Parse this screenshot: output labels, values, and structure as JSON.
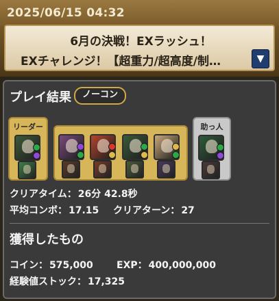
{
  "header": {
    "timestamp": "2025/06/15 04:32",
    "quest_line1": "6月の決戦！EXラッシュ！",
    "quest_line2": "EXチャレンジ！【超重力/超高度/制…",
    "expand_icon": "triangle-down-icon"
  },
  "result": {
    "title": "プレイ結果",
    "badge": "ノーコン"
  },
  "party": {
    "leader_label": "リーダー",
    "helper_label": "助っ人",
    "colors": {
      "leader_group": "#d7b659",
      "helper_group": "#c9c9c9"
    },
    "leader": {
      "name": "leader-card",
      "color": "#3d5a3a",
      "orbs": [
        "#2ba84a",
        "#8e4ad6"
      ],
      "assist_color": "#3f7f4a"
    },
    "subs": [
      {
        "name": "sub-card-1",
        "color": "#7a4a7e",
        "orbs": [
          "#8e4ad6",
          "#2ba84a"
        ],
        "assist_color": "#5b3a2a"
      },
      {
        "name": "sub-card-2",
        "color": "#b2452e",
        "orbs": [
          "#d8382c",
          "#ddb84a"
        ],
        "assist_color": "#7a3b28"
      },
      {
        "name": "sub-card-3",
        "color": "#3a5a3a",
        "orbs": [
          "#2ba84a",
          "#ddb84a"
        ],
        "assist_color": "#4a5a3a"
      },
      {
        "name": "sub-card-4",
        "color": "#c9a87a",
        "orbs": [
          "#ddb84a",
          "#2ba84a"
        ],
        "assist_color": "#4a3a5a"
      }
    ],
    "helper": {
      "name": "helper-card",
      "color": "#2e5b3a",
      "orbs": [
        "#2ba84a",
        "#8e4ad6"
      ],
      "assist_color": "#4a3a3a"
    }
  },
  "stats": {
    "clear_time_label": "クリアタイム：",
    "clear_time_value": "26分 42.8秒",
    "avg_combo_label": "平均コンボ：",
    "avg_combo_value": "17.15",
    "clear_turn_label": "クリアターン：",
    "clear_turn_value": "27"
  },
  "rewards": {
    "title": "獲得したもの",
    "coin_label": "コイン：",
    "coin_value": "575,000",
    "exp_label": "EXP：",
    "exp_value": "400,000,000",
    "stock_label": "経験値ストック：",
    "stock_value": "17,325"
  }
}
